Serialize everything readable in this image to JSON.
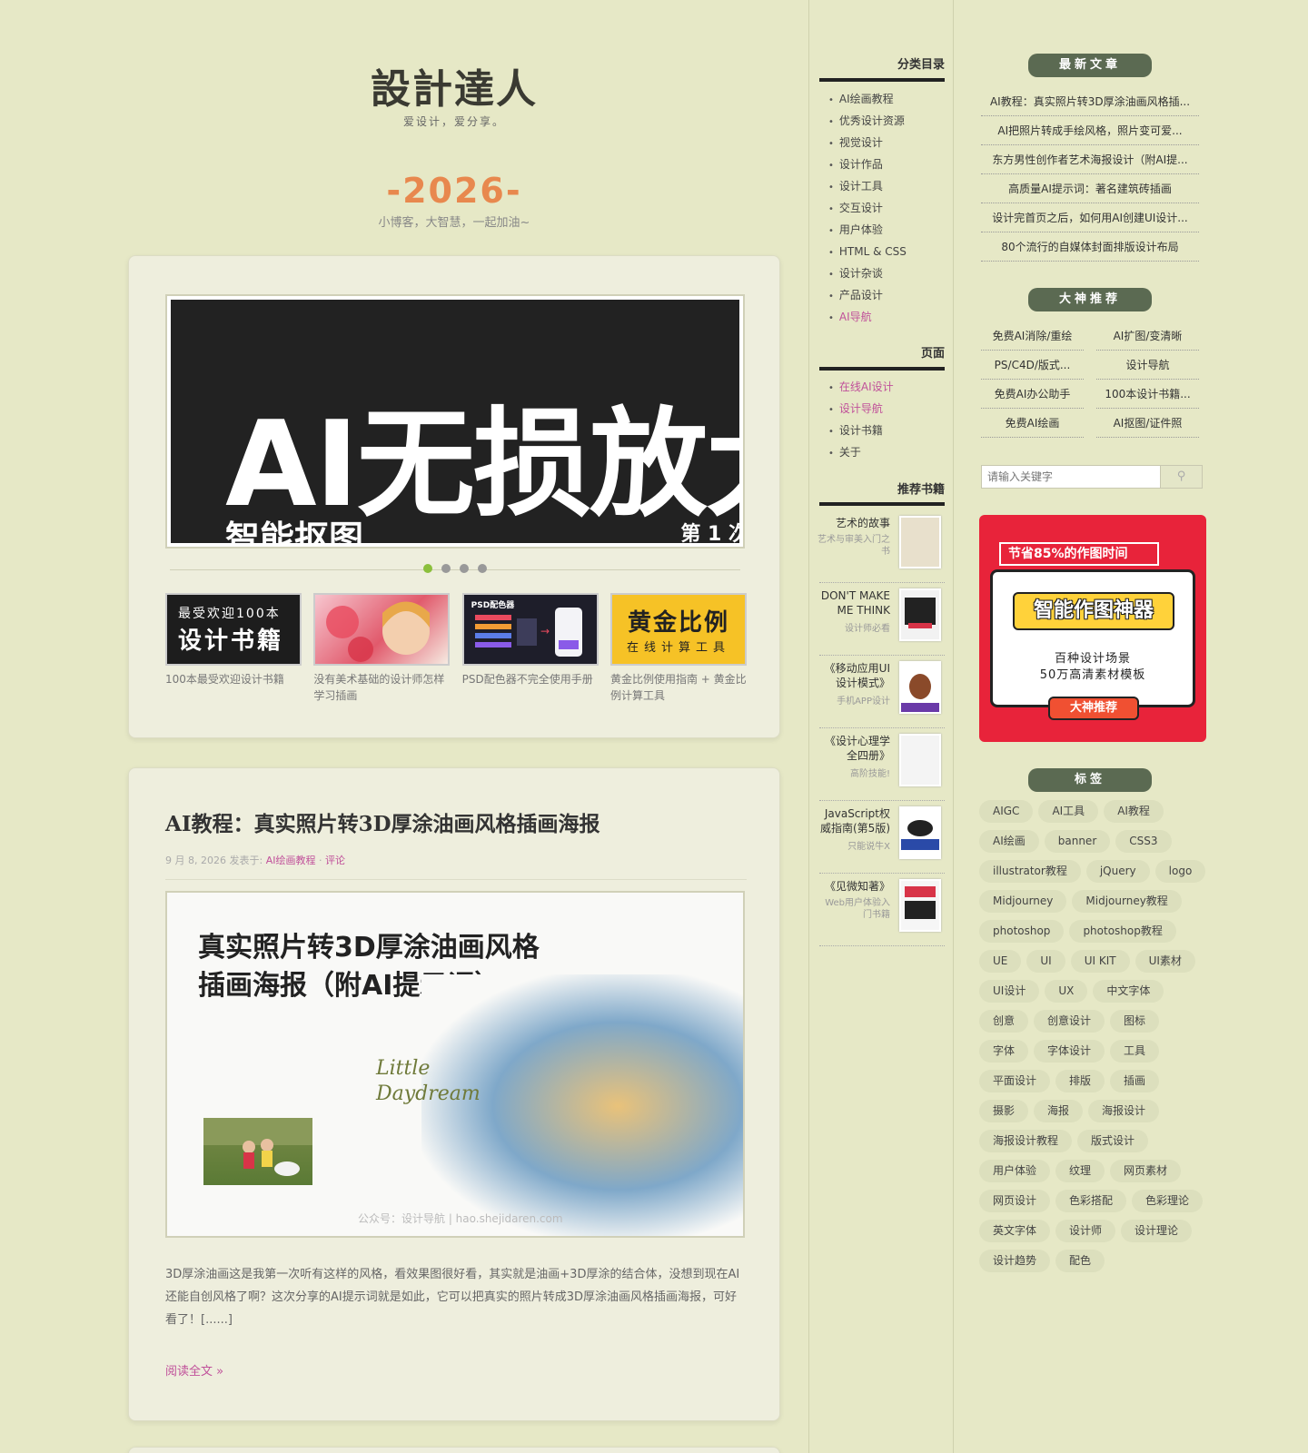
{
  "header": {
    "title": "設計達人",
    "subtitle": "爱设计，爱分享。",
    "year": "-2026-",
    "slogan": "小博客，大智慧，一起加油~"
  },
  "slider": {
    "big_text": "AI无损放大",
    "small_text": "智能抠图",
    "corner_text": "第 1 次",
    "dots": 4,
    "active_dot": 1
  },
  "thumbs": [
    {
      "img_line1": "最受欢迎100本",
      "img_line2": "设计书籍",
      "caption": "100本最受欢迎设计书籍"
    },
    {
      "caption": "没有美术基础的设计师怎样学习插画"
    },
    {
      "img_label": "PSD配色器",
      "caption": "PSD配色器不完全使用手册"
    },
    {
      "img_line1": "黄金比例",
      "img_line2": "在线计算工具",
      "caption": "黄金比例使用指南 + 黄金比例计算工具"
    }
  ],
  "post": {
    "title": "AI教程：真实照片转3D厚涂油画风格插画海报",
    "meta_date": "9 月 8, 2026 发表于:",
    "meta_category": "AI绘画教程",
    "meta_sep": "·",
    "meta_comment": "评论",
    "image_title_line1": "真实照片转3D厚涂油画风格",
    "image_title_line2": "插画海报（附AI提示词）",
    "image_script": "Little Daydream",
    "image_footer": "公众号：设计导航 | hao.shejidaren.com",
    "excerpt": "3D厚涂油画这是我第一次听有这样的风格，看效果图很好看，其实就是油画+3D厚涂的结合体，没想到现在AI还能自创风格了啊？这次分享的AI提示词就是如此，它可以把真实的照片转成3D厚涂油画风格插画海报，可好看了！[......]",
    "read_more": "阅读全文 »"
  },
  "middle_sidebar": {
    "categories_title": "分类目录",
    "categories": [
      "AI绘画教程",
      "优秀设计资源",
      "视觉设计",
      "设计作品",
      "设计工具",
      "交互设计",
      "用户体验",
      "HTML & CSS",
      "设计杂谈",
      "产品设计",
      "AI导航"
    ],
    "pages_title": "页面",
    "pages": [
      "在线AI设计",
      "设计导航",
      "设计书籍",
      "关于"
    ],
    "books_title": "推荐书籍",
    "books": [
      {
        "title": "艺术的故事",
        "sub": "艺术与审美入门之书",
        "cover": "#e8e0cc"
      },
      {
        "title": "DON'T MAKE ME THINK",
        "sub": "设计师必看",
        "cover": "#f2f2f2"
      },
      {
        "title": "《移动应用UI设计模式》",
        "sub": "手机APP设计",
        "cover": "#ffffff"
      },
      {
        "title": "《设计心理学全四册》",
        "sub": "高阶技能!",
        "cover": "#f4f4f4"
      },
      {
        "title": "JavaScript权威指南(第5版)",
        "sub": "只能说牛X",
        "cover": "#ffffff"
      },
      {
        "title": "《见微知著》",
        "sub": "Web用户体验入门书籍",
        "cover": "#f6f6f6"
      }
    ]
  },
  "right_sidebar": {
    "latest_title": "最新文章",
    "latest": [
      "AI教程：真实照片转3D厚涂油画风格插...",
      "AI把照片转成手绘风格，照片变可爱...",
      "东方男性创作者艺术海报设计（附AI提...",
      "高质量AI提示词：著名建筑砖插画",
      "设计完首页之后，如何用AI创建UI设计...",
      "80个流行的自媒体封面排版设计布局"
    ],
    "recommend_title": "大神推荐",
    "recommend": [
      "免费AI消除/重绘",
      "AI扩图/变清晰",
      "PS/C4D/版式...",
      "设计导航",
      "免费AI办公助手",
      "100本设计书籍...",
      "免费AI绘画",
      "AI抠图/证件照"
    ],
    "search_placeholder": "请输入关键字",
    "ad": {
      "top": "节省85%的作图时间",
      "title": "智能作图神器",
      "line1": "百种设计场景",
      "line2": "50万高清素材模板",
      "button": "大神推荐"
    },
    "tags_title": "标签",
    "tags": [
      "AIGC",
      "AI工具",
      "AI教程",
      "AI绘画",
      "banner",
      "CSS3",
      "illustrator教程",
      "jQuery",
      "logo",
      "Midjourney",
      "Midjourney教程",
      "photoshop",
      "photoshop教程",
      "UE",
      "UI",
      "UI KIT",
      "UI素材",
      "UI设计",
      "UX",
      "中文字体",
      "创意",
      "创意设计",
      "图标",
      "字体",
      "字体设计",
      "工具",
      "平面设计",
      "排版",
      "插画",
      "摄影",
      "海报",
      "海报设计",
      "海报设计教程",
      "版式设计",
      "用户体验",
      "纹理",
      "网页素材",
      "网页设计",
      "色彩搭配",
      "色彩理论",
      "英文字体",
      "设计师",
      "设计理论",
      "设计趋势",
      "配色"
    ]
  }
}
